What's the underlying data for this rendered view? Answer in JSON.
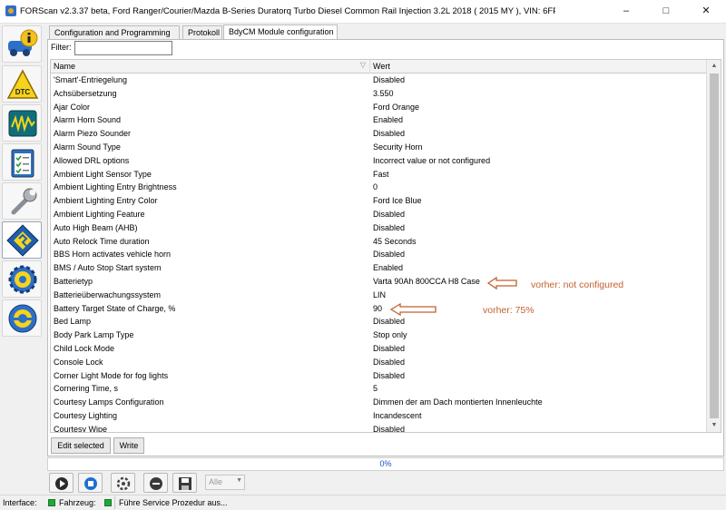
{
  "window": {
    "title": "FORScan v2.3.37 beta, Ford Ranger/Courier/Mazda B-Series Duratorq Turbo Diesel Common Rail Injection 3.2L 2018 ( 2015 MY ), VIN: 6FP*********",
    "minimize": "–",
    "maximize": "□",
    "close": "✕"
  },
  "sidebar": {
    "items": [
      {
        "name": "info-icon"
      },
      {
        "name": "dtc-icon",
        "label": "DTC"
      },
      {
        "name": "oscilloscope-icon"
      },
      {
        "name": "checklist-icon"
      },
      {
        "name": "wrench-icon"
      },
      {
        "name": "chip-icon"
      },
      {
        "name": "gear-icon"
      },
      {
        "name": "steering-wheel-icon"
      }
    ]
  },
  "tabs": [
    {
      "label": "Configuration and Programming"
    },
    {
      "label": "Protokoll"
    },
    {
      "label": "BdyCM Module configuration"
    }
  ],
  "filter": {
    "label": "Filter:",
    "value": ""
  },
  "table": {
    "headers": {
      "name": "Name",
      "value": "Wert"
    },
    "rows": [
      {
        "name": "'Smart'-Entriegelung",
        "value": "Disabled"
      },
      {
        "name": "Achsübersetzung",
        "value": "3.550"
      },
      {
        "name": "Ajar Color",
        "value": "Ford Orange"
      },
      {
        "name": "Alarm Horn Sound",
        "value": "Enabled"
      },
      {
        "name": "Alarm Piezo Sounder",
        "value": "Disabled"
      },
      {
        "name": "Alarm Sound Type",
        "value": "Security Horn"
      },
      {
        "name": "Allowed DRL options",
        "value": "Incorrect value or not configured"
      },
      {
        "name": "Ambient Light Sensor Type",
        "value": "Fast"
      },
      {
        "name": "Ambient Lighting Entry Brightness",
        "value": "0"
      },
      {
        "name": "Ambient Lighting Entry Color",
        "value": "Ford Ice Blue"
      },
      {
        "name": "Ambient Lighting Feature",
        "value": "Disabled"
      },
      {
        "name": "Auto High Beam (AHB)",
        "value": "Disabled"
      },
      {
        "name": "Auto Relock Time duration",
        "value": "45 Seconds"
      },
      {
        "name": "BBS Horn activates vehicle horn",
        "value": "Disabled"
      },
      {
        "name": "BMS / Auto Stop Start system",
        "value": "Enabled"
      },
      {
        "name": "Batterietyp",
        "value": "Varta 90Ah 800CCA H8 Case"
      },
      {
        "name": "Batterieüberwachungssystem",
        "value": "LIN"
      },
      {
        "name": "Battery Target State of Charge, %",
        "value": "90"
      },
      {
        "name": "Bed Lamp",
        "value": "Disabled"
      },
      {
        "name": "Body Park Lamp Type",
        "value": "Stop only"
      },
      {
        "name": "Child Lock Mode",
        "value": "Disabled"
      },
      {
        "name": "Console Lock",
        "value": "Disabled"
      },
      {
        "name": "Corner Light Mode for fog lights",
        "value": "Disabled"
      },
      {
        "name": "Cornering Time, s",
        "value": "5"
      },
      {
        "name": "Courtesy Lamps Configuration",
        "value": "Dimmen der am Dach montierten Innenleuchte"
      },
      {
        "name": "Courtesy Lighting",
        "value": "Incandescent"
      },
      {
        "name": "Courtesy Wipe",
        "value": "Disabled"
      }
    ]
  },
  "buttons": {
    "edit": "Edit selected",
    "write": "Write"
  },
  "progress": {
    "text": "0%",
    "fraction": 0
  },
  "toolbar": {
    "icons": [
      "play-icon",
      "stop-icon",
      "cycle-icon",
      "cancel-icon",
      "save-icon"
    ],
    "select_value": "Alle"
  },
  "statusbar": {
    "interface_label": "Interface:",
    "vehicle_label": "Fahrzeug:",
    "message": "Führe Service Prozedur aus..."
  },
  "annotations": {
    "note1": "vorher: not configured",
    "note2": "vorher: 75%",
    "color": "#c0622f"
  }
}
